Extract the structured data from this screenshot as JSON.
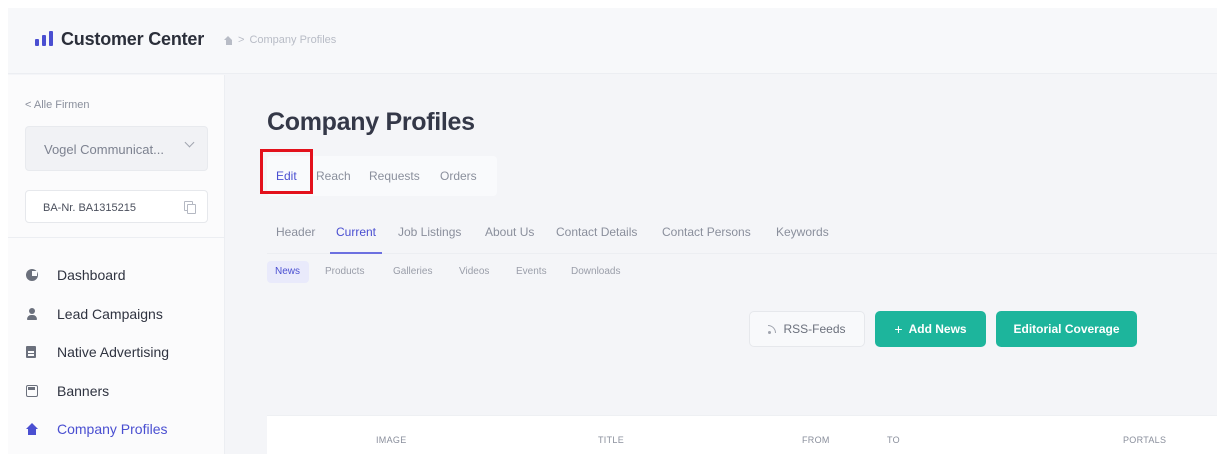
{
  "header": {
    "app_title": "Customer Center",
    "breadcrumb_sep": ">",
    "breadcrumb_page": "Company Profiles"
  },
  "sidebar": {
    "back_link": "< Alle Firmen",
    "company_select": "Vogel Communicat...",
    "ba_number": "BA-Nr. BA1315215",
    "items": [
      {
        "label": "Dashboard",
        "icon": "dashboard-icon"
      },
      {
        "label": "Lead Campaigns",
        "icon": "user-icon"
      },
      {
        "label": "Native Advertising",
        "icon": "document-icon"
      },
      {
        "label": "Banners",
        "icon": "banner-icon"
      },
      {
        "label": "Company Profiles",
        "icon": "home-icon",
        "active": true
      }
    ]
  },
  "main": {
    "title": "Company Profiles",
    "primary_tabs": [
      "Edit",
      "Reach",
      "Requests",
      "Orders"
    ],
    "section_tabs": [
      "Header",
      "Current",
      "Job Listings",
      "About Us",
      "Contact Details",
      "Contact Persons",
      "Keywords"
    ],
    "sub_tabs": [
      "News",
      "Products",
      "Galleries",
      "Videos",
      "Events",
      "Downloads"
    ],
    "buttons": {
      "rss": "RSS-Feeds",
      "add_news": "Add News",
      "add_news_prefix": "+",
      "editorial": "Editorial Coverage"
    },
    "table_columns": [
      "IMAGE",
      "TITLE",
      "FROM",
      "TO",
      "PORTALS"
    ]
  },
  "colors": {
    "accent": "#4a4fd1",
    "primary_button": "#1db59c",
    "highlight": "#e3111c"
  }
}
